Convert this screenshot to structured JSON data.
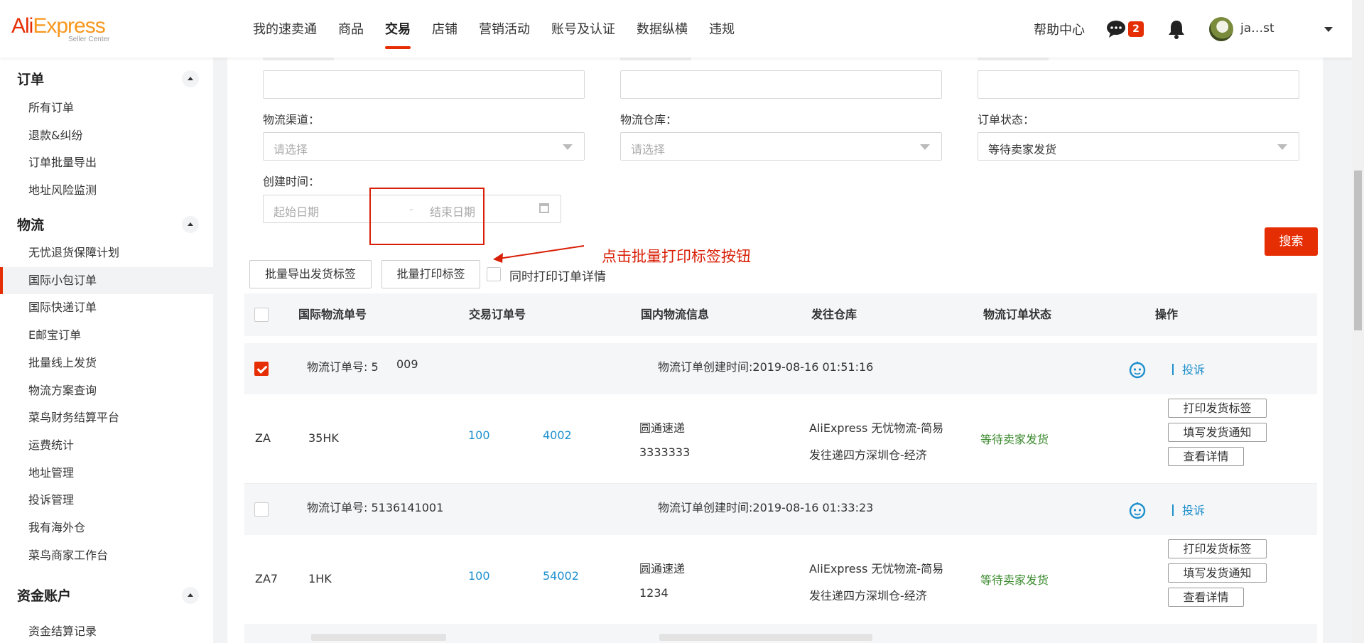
{
  "header": {
    "logo": {
      "brand_a": "Ali",
      "brand_b": "Express",
      "subtitle": "Seller Center"
    },
    "nav": [
      {
        "label": "我的速卖通"
      },
      {
        "label": "商品"
      },
      {
        "label": "交易",
        "active": true
      },
      {
        "label": "店铺"
      },
      {
        "label": "营销活动"
      },
      {
        "label": "账号及认证"
      },
      {
        "label": "数据纵横"
      },
      {
        "label": "违规"
      }
    ],
    "help": "帮助中心",
    "message_count": "2",
    "user_name": "ja…st"
  },
  "sidebar": {
    "groups": [
      {
        "title": "订单",
        "items": [
          "所有订单",
          "退款&纠纷",
          "订单批量导出",
          "地址风险监测"
        ]
      },
      {
        "title": "物流",
        "items": [
          "无忧退货保障计划",
          "国际小包订单",
          "国际快递订单",
          "E邮宝订单",
          "批量线上发货",
          "物流方案查询",
          "菜鸟财务结算平台",
          "运费统计",
          "地址管理",
          "投诉管理",
          "我有海外仓",
          "菜鸟商家工作台"
        ]
      },
      {
        "title": "资金账户",
        "items": [
          "资金结算记录"
        ]
      }
    ],
    "active_item": "国际小包订单"
  },
  "filters": {
    "logistics_channel": {
      "label": "物流渠道：",
      "placeholder": "请选择"
    },
    "logistics_warehouse": {
      "label": "物流仓库：",
      "placeholder": "请选择"
    },
    "order_status": {
      "label": "订单状态：",
      "value": "等待卖家发货"
    },
    "create_time": {
      "label": "创建时间：",
      "start_placeholder": "起始日期",
      "separator": "-",
      "end_placeholder": "结束日期"
    },
    "search_button": "搜索"
  },
  "toolbar": {
    "batch_export_label": "批量导出发货标签",
    "batch_print_label": "批量打印标签",
    "print_detail_label": "同时打印订单详情"
  },
  "annotation": {
    "text": "点击批量打印标签按钮",
    "color": "#d81e06"
  },
  "table": {
    "columns": [
      "国际物流单号",
      "交易订单号",
      "国内物流信息",
      "发往仓库",
      "物流订单状态",
      "操作"
    ],
    "complaint_label": "投诉",
    "actions": [
      "打印发货标签",
      "填写发货通知",
      "查看详情"
    ],
    "orders": [
      {
        "selected": true,
        "logistics_order_label": "物流订单号: 5",
        "logistics_order_tail": "009",
        "created": "物流订单创建时间:2019-08-16 01:51:16",
        "intl_no_head": "ZA",
        "intl_no_tail": "35HK",
        "trade_no_head": "100",
        "trade_no_tail": "4002",
        "carrier": "圆通速递",
        "tracking": "3333333",
        "warehouse_line1": "AliExpress 无忧物流-简易",
        "warehouse_line2": "发往递四方深圳仓-经济",
        "status": "等待卖家发货"
      },
      {
        "selected": false,
        "logistics_order_label": "物流订单号: 5136141001",
        "logistics_order_tail": "",
        "created": "物流订单创建时间:2019-08-16 01:33:23",
        "intl_no_head": "ZA7",
        "intl_no_tail": "1HK",
        "trade_no_head": "100",
        "trade_no_tail": "54002",
        "carrier": "圆通速递",
        "tracking": "1234",
        "warehouse_line1": "AliExpress 无忧物流-简易",
        "warehouse_line2": "发往递四方深圳仓-经济",
        "status": "等待卖家发货"
      }
    ]
  }
}
